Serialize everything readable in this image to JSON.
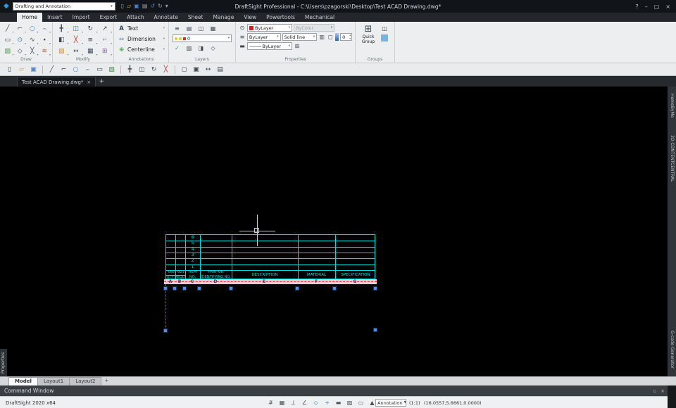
{
  "ui": {
    "caret_down": "▾",
    "caret_up": "▴",
    "dropdown_caret": "▼"
  },
  "titlebar": {
    "app_title": "DraftSight Professional - C:\\Users\\pzagorski\\Desktop\\Test ACAD Drawing.dwg*",
    "workspace": "Drafting and Annotation",
    "logo_glyph": "◆",
    "quick_access": [
      {
        "name": "new-file-icon",
        "glyph": "▯"
      },
      {
        "name": "open-file-icon",
        "glyph": "▱",
        "color": "#d9a43b"
      },
      {
        "name": "save-icon",
        "glyph": "▣",
        "color": "#4d82c8"
      },
      {
        "name": "print-icon",
        "glyph": "▤"
      },
      {
        "name": "undo-icon",
        "glyph": "↺",
        "color": "#4d82c8"
      },
      {
        "name": "redo-icon",
        "glyph": "↻"
      },
      {
        "name": "qat-menu-icon",
        "glyph": "▾"
      }
    ],
    "help_glyph": "?",
    "minimize_glyph": "–",
    "restore_glyph": "▢",
    "close_glyph": "×"
  },
  "ribbon": {
    "tabs": [
      {
        "label": "Home",
        "active": true
      },
      {
        "label": "Insert"
      },
      {
        "label": "Import"
      },
      {
        "label": "Export"
      },
      {
        "label": "Attach"
      },
      {
        "label": "Annotate"
      },
      {
        "label": "Sheet"
      },
      {
        "label": "Manage"
      },
      {
        "label": "View"
      },
      {
        "label": "Powertools"
      },
      {
        "label": "Mechanical"
      }
    ],
    "draw": {
      "label": "Draw",
      "icons": [
        {
          "name": "line-icon",
          "glyph": "╱"
        },
        {
          "name": "polyline-icon",
          "glyph": "⌐"
        },
        {
          "name": "circle-icon",
          "glyph": "○",
          "color": "#3a7ebf"
        },
        {
          "name": "arc-icon",
          "glyph": "⌢"
        },
        {
          "name": "rectangle-icon",
          "glyph": "▭"
        },
        {
          "name": "ellipse-icon",
          "glyph": "⊙",
          "color": "#3a7ebf"
        },
        {
          "name": "spline-icon",
          "glyph": "∿"
        },
        {
          "name": "point-icon",
          "glyph": "∙"
        },
        {
          "name": "hatch-icon",
          "glyph": "▨",
          "color": "#4a8f4a"
        },
        {
          "name": "polygon-icon",
          "glyph": "◇"
        },
        {
          "name": "infinite-line-icon",
          "glyph": "╳"
        },
        {
          "name": "revision-cloud-icon",
          "glyph": "≋",
          "color": "#b06030"
        }
      ]
    },
    "modify": {
      "label": "Modify",
      "icons": [
        {
          "name": "move-icon",
          "glyph": "╋"
        },
        {
          "name": "copy-icon",
          "glyph": "◫",
          "color": "#3a7ebf"
        },
        {
          "name": "rotate-icon",
          "glyph": "↻"
        },
        {
          "name": "scale-icon",
          "glyph": "↗"
        },
        {
          "name": "mirror-icon",
          "glyph": "◧"
        },
        {
          "name": "trim-icon",
          "glyph": "╳",
          "color": "#b03030"
        },
        {
          "name": "offset-icon",
          "glyph": "≡"
        },
        {
          "name": "fillet-icon",
          "glyph": "⌐",
          "color": "#3a7ebf"
        },
        {
          "name": "explode-icon",
          "glyph": "▨",
          "color": "#d98a2b"
        },
        {
          "name": "stretch-icon",
          "glyph": "↔"
        },
        {
          "name": "pattern-icon",
          "glyph": "▦"
        },
        {
          "name": "erase-icon",
          "glyph": "⊞",
          "color": "#8a5fa0"
        }
      ]
    },
    "annotations": {
      "label": "Annotations",
      "text_icon": "A",
      "text_label": "Text",
      "dimension_icon": "↔",
      "dimension_label": "Dimension",
      "centerline_icon": "⊕",
      "centerline_label": "Centerline"
    },
    "layers": {
      "label": "Layers",
      "row1_icons": [
        {
          "name": "layers-manager-icon",
          "glyph": "≡"
        },
        {
          "name": "layer-preview-icon",
          "glyph": "▤"
        },
        {
          "name": "layer-isolate-icon",
          "glyph": "◫"
        },
        {
          "name": "layer-freeze-icon",
          "glyph": "▦"
        }
      ],
      "active_layer": "0",
      "row3_icons": [
        {
          "name": "layer-states-icon",
          "glyph": "✓",
          "color": "#3f9e3f"
        },
        {
          "name": "layer-hide-icon",
          "glyph": "▧"
        },
        {
          "name": "layer-lock-icon",
          "glyph": "◨"
        },
        {
          "name": "layer-match-icon",
          "glyph": "◇"
        }
      ]
    },
    "properties_group": {
      "label": "Properties",
      "row1_icon": "⊙",
      "line_color_value": "ByLayer",
      "swatch_color": "#cc2222",
      "bycolor_value": "ByColor",
      "row2_icon": "≡",
      "line_weight_value": "ByLayer",
      "line_style_value": "Solid line",
      "row2_icons": [
        {
          "name": "match-properties-icon",
          "glyph": "▥"
        },
        {
          "name": "entity-transparency-icon",
          "glyph": "◻"
        }
      ],
      "transparency_value": "0",
      "row3_icon": "▬",
      "line_preview": "———",
      "line_pattern_value": "ByLayer",
      "row3_icons": [
        {
          "name": "make-flat-icon",
          "glyph": "⊞"
        }
      ]
    },
    "groups_group": {
      "label": "Groups",
      "main_icon": "⊞",
      "quick_group_label": "Quick Group",
      "side_icon": "◫",
      "swatch_color": "#7ab3d9"
    }
  },
  "quickbar": {
    "icons": [
      {
        "name": "new-drawing-icon",
        "glyph": "▯"
      },
      {
        "name": "open-drawing-icon",
        "glyph": "▱",
        "color": "#c89a3a"
      },
      {
        "name": "save-drawing-icon",
        "glyph": "▣",
        "color": "#4d82c8"
      },
      {
        "sep": true
      },
      {
        "name": "line-tool-icon",
        "glyph": "╱"
      },
      {
        "name": "polyline-tool-icon",
        "glyph": "⌐"
      },
      {
        "name": "circle-tool-icon",
        "glyph": "○",
        "color": "#3a7ebf"
      },
      {
        "name": "arc-tool-icon",
        "glyph": "⌢"
      },
      {
        "name": "rectangle-tool-icon",
        "glyph": "▭"
      },
      {
        "name": "hatch-tool-icon",
        "glyph": "▨",
        "color": "#4a8f4a"
      },
      {
        "sep": true
      },
      {
        "name": "move-tool-icon",
        "glyph": "╋"
      },
      {
        "name": "copy-tool-icon",
        "glyph": "◫"
      },
      {
        "name": "rotate-tool-icon",
        "glyph": "↻"
      },
      {
        "name": "trim-tool-icon",
        "glyph": "╳",
        "color": "#b03030"
      },
      {
        "sep": true
      },
      {
        "name": "zoom-window-icon",
        "glyph": "◻"
      },
      {
        "name": "zoom-fit-icon",
        "glyph": "▣"
      },
      {
        "name": "pan-icon",
        "glyph": "↔"
      },
      {
        "name": "properties-panel-icon",
        "glyph": "▤"
      }
    ]
  },
  "document_tabs": {
    "active_label": "Test ACAD Drawing.dwg*",
    "close_glyph": "×",
    "add_glyph": "+"
  },
  "panels": {
    "left_tab": "Properties",
    "right_tabs": [
      {
        "label": "HomeByMe",
        "name": "homebyme-panel-tab"
      },
      {
        "label": "3D CONTENTCENTRAL",
        "name": "contentcentral-panel-tab"
      },
      {
        "label": "G-code Generator",
        "name": "gcode-generator-panel-tab"
      }
    ]
  },
  "drawing": {
    "colors": {
      "entity": "#00d9d9",
      "selection_fill": "#edccd8",
      "selection_dash": "#d83030",
      "grip": "#4f8fe8",
      "grip_border": "#17365e",
      "selected_line": "#e03030",
      "crosshair": "#c9ccd0",
      "letter": "#2c4a70"
    },
    "table": {
      "item_numbers": [
        "6",
        "5",
        "4",
        "3",
        "2",
        "1"
      ],
      "header": {
        "dash_left": "-002",
        "dash_right": "-001",
        "qty": "QTY REQD",
        "item_line1": "ITEM",
        "item_line2": "NO.",
        "part_line1": "PART OR",
        "part_line2": "IDENTIFYING NO.",
        "description": "DESCRIPTION",
        "material": "MATERIAL",
        "specification": "SPECIFICATION"
      },
      "column_letters": [
        "A",
        "B",
        "C",
        "D",
        "E",
        "F",
        "G"
      ]
    }
  },
  "layout_tabs": {
    "tabs": [
      {
        "label": "Model",
        "active": true
      },
      {
        "label": "Layout1"
      },
      {
        "label": "Layout2"
      }
    ],
    "add_glyph": "+"
  },
  "command_window": {
    "title": "Command Window",
    "float_glyph": "▫",
    "close_glyph": "×"
  },
  "statusbar": {
    "app_version": "DraftSight 2020 x64",
    "icons": [
      {
        "name": "snap-icon",
        "glyph": "#"
      },
      {
        "name": "grid-icon",
        "glyph": "▦"
      },
      {
        "name": "ortho-icon",
        "glyph": "⊥"
      },
      {
        "name": "polar-icon",
        "glyph": "∠"
      },
      {
        "name": "esnap-icon",
        "glyph": "◇",
        "color": "#3a7ebf"
      },
      {
        "name": "etrack-icon",
        "glyph": "+",
        "color": "#3a7ebf"
      },
      {
        "name": "lineweight-icon",
        "glyph": "▬"
      },
      {
        "name": "transparency-icon",
        "glyph": "▨"
      },
      {
        "name": "quick-input-icon",
        "glyph": "▭"
      },
      {
        "name": "annotation-monitor-icon",
        "glyph": "▲"
      }
    ],
    "annotation_scale": "Annotation",
    "view_scale": "(1:1)",
    "coordinates": "(16.0557,5.6661,0.0000)"
  }
}
